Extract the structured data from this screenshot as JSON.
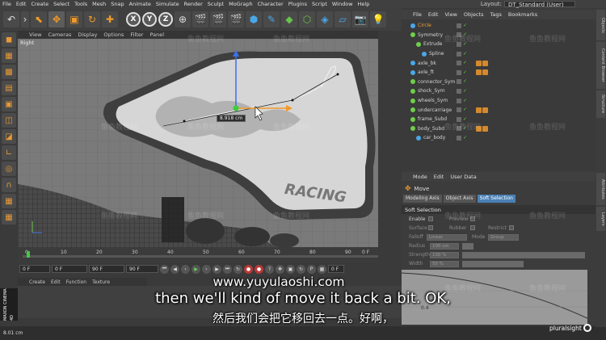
{
  "menubar": {
    "items": [
      "File",
      "Edit",
      "Create",
      "Select",
      "Tools",
      "Mesh",
      "Snap",
      "Animate",
      "Simulate",
      "Render",
      "Sculpt",
      "MoGraph",
      "Character",
      "Plugins",
      "Script",
      "Window",
      "Help"
    ],
    "layout_label": "Layout:",
    "layout_value": "DT_Standard (User)"
  },
  "toolbar": {
    "axis_buttons": [
      "X",
      "Y",
      "Z"
    ]
  },
  "viewport": {
    "menu": [
      "View",
      "Cameras",
      "Display",
      "Options",
      "Filter",
      "Panel"
    ],
    "label": "Right",
    "hud_value": "8.918 cm",
    "decal_text": "RACING"
  },
  "timeline": {
    "ticks": [
      "0",
      "10",
      "20",
      "30",
      "40",
      "50",
      "60",
      "70",
      "80",
      "90"
    ],
    "frame_end_suffix": "0 F"
  },
  "transport": {
    "field_start": "0 F",
    "field_current": "0 F",
    "field_end": "90 F",
    "field_max": "90 F",
    "field_frame": "0 F"
  },
  "material_manager": {
    "menu": [
      "Create",
      "Edit",
      "Function",
      "Texture"
    ]
  },
  "branding": {
    "maxon": "MAXON CINEMA 4D"
  },
  "status": {
    "coord": "8.01 cm"
  },
  "object_manager": {
    "menu": [
      "File",
      "Edit",
      "View",
      "Objects",
      "Tags",
      "Bookmarks"
    ],
    "objects": [
      {
        "name": "Circle",
        "indent": 1,
        "color": "#4aa7e8",
        "selected": true
      },
      {
        "name": "Symmetry",
        "indent": 1,
        "color": "#6fcf4a",
        "selected": false
      },
      {
        "name": "Extrude",
        "indent": 2,
        "color": "#6fcf4a",
        "selected": false
      },
      {
        "name": "Spline",
        "indent": 3,
        "color": "#4aa7e8",
        "selected": false
      },
      {
        "name": "axle_bk",
        "indent": 1,
        "color": "#4aa7e8",
        "selected": false
      },
      {
        "name": "axle_ft",
        "indent": 1,
        "color": "#4aa7e8",
        "selected": false
      },
      {
        "name": "connector_Sym",
        "indent": 1,
        "color": "#6fcf4a",
        "selected": false
      },
      {
        "name": "shock_Sym",
        "indent": 1,
        "color": "#6fcf4a",
        "selected": false
      },
      {
        "name": "wheels_Sym",
        "indent": 1,
        "color": "#6fcf4a",
        "selected": false
      },
      {
        "name": "undercarriage",
        "indent": 1,
        "color": "#6fcf4a",
        "selected": false
      },
      {
        "name": "frame_Subd",
        "indent": 1,
        "color": "#6fcf4a",
        "selected": false
      },
      {
        "name": "body_Subd",
        "indent": 1,
        "color": "#6fcf4a",
        "selected": false
      },
      {
        "name": "car_body",
        "indent": 2,
        "color": "#4aa7e8",
        "selected": false
      }
    ]
  },
  "attributes": {
    "menu": [
      "Mode",
      "Edit",
      "User Data"
    ],
    "title": "Move",
    "tabs": [
      "Modeling Axis",
      "Object Axis",
      "Soft Selection"
    ],
    "active_tab": "Soft Selection",
    "section": "Soft Selection",
    "enable_label": "Enable",
    "preview_label": "Preview",
    "surface_label": "Surface",
    "rubber_label": "Rubber",
    "restrict_label": "Restrict",
    "falloff_label": "Falloff",
    "falloff_value": "Linear",
    "mode_label": "Mode",
    "mode_value": "Group",
    "radius_label": "Radius",
    "radius_value": "100 cm",
    "strength_label": "Strength",
    "strength_value": "100 %",
    "width_label": "Width",
    "width_value": "50 %",
    "graph_tick": "0.4"
  },
  "right_strip": {
    "tabs": [
      "Objects",
      "Content Browser",
      "Structure",
      "Attributes",
      "Layers"
    ]
  },
  "subtitles": {
    "url": "www.yuyulaoshi.com",
    "english": "then we'll kind of move it back a bit. OK,",
    "chinese": "然后我们会把它移回去一点。好啊，"
  },
  "watermark": "鱼鱼教程网",
  "logo": "pluralsight"
}
